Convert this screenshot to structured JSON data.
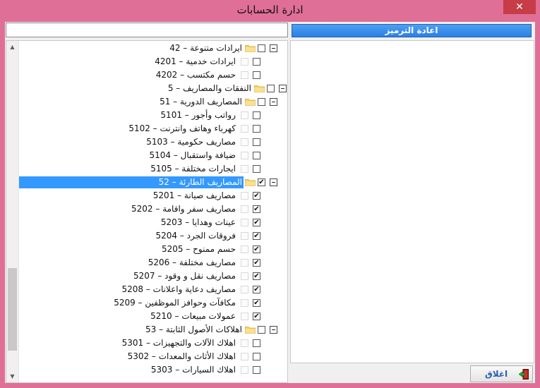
{
  "window": {
    "title": "ادارة الحسابات",
    "close_glyph": "✕"
  },
  "search": {
    "value": "",
    "placeholder": ""
  },
  "reset_button": {
    "label": "اعادة الترميز"
  },
  "close_button": {
    "label": "اغلاق"
  },
  "tree": [
    {
      "text": "42 – ايرادات متنوعة",
      "level": 1,
      "type": "folder",
      "checked": false
    },
    {
      "text": "4201 – ايرادات خدمية",
      "level": 2,
      "type": "leaf",
      "checked": false
    },
    {
      "text": "4202 – حسم مكتسب",
      "level": 2,
      "type": "leaf",
      "checked": false
    },
    {
      "text": "5 – النفقات والمصاريف",
      "level": 0,
      "type": "folder",
      "checked": false
    },
    {
      "text": "51 – المصاريف الدورية",
      "level": 1,
      "type": "folder",
      "checked": false
    },
    {
      "text": "5101 – رواتب وأجور",
      "level": 2,
      "type": "leaf",
      "checked": false
    },
    {
      "text": "5102 – كهرباء وهاتف وانترنت",
      "level": 2,
      "type": "leaf",
      "checked": false
    },
    {
      "text": "5103 – مصاريف حكومية",
      "level": 2,
      "type": "leaf",
      "checked": false
    },
    {
      "text": "5104 – ضيافة واستقبال",
      "level": 2,
      "type": "leaf",
      "checked": false
    },
    {
      "text": "5105 – ايجارات مختلفة",
      "level": 2,
      "type": "leaf",
      "checked": false
    },
    {
      "text": "52 – المصاريف الطارئة",
      "level": 1,
      "type": "folder",
      "checked": true,
      "selected": true
    },
    {
      "text": "5201 – مصاريف صيانة",
      "level": 2,
      "type": "leaf",
      "checked": true
    },
    {
      "text": "5202 – مصاريف سفر واقامة",
      "level": 2,
      "type": "leaf",
      "checked": true
    },
    {
      "text": "5203 – عينات وهدايا",
      "level": 2,
      "type": "leaf",
      "checked": true
    },
    {
      "text": "5204 – فروقات الجرد",
      "level": 2,
      "type": "leaf",
      "checked": true
    },
    {
      "text": "5205 – حسم ممنوح",
      "level": 2,
      "type": "leaf",
      "checked": true
    },
    {
      "text": "5206 – مصاريف مختلفة",
      "level": 2,
      "type": "leaf",
      "checked": true
    },
    {
      "text": "5207 – مصاريف نقل و وقود",
      "level": 2,
      "type": "leaf",
      "checked": true
    },
    {
      "text": "5208 – مصاريف دعاية واعلانات",
      "level": 2,
      "type": "leaf",
      "checked": true
    },
    {
      "text": "5209 – مكافآت وحوافز الموظفين",
      "level": 2,
      "type": "leaf",
      "checked": true
    },
    {
      "text": "5210 – عمولات مبيعات",
      "level": 2,
      "type": "leaf",
      "checked": true
    },
    {
      "text": "53 – اهلاكات الأصول الثابتة",
      "level": 1,
      "type": "folder",
      "checked": false
    },
    {
      "text": "5301 – اهلاك الآلات والتجهيزات",
      "level": 2,
      "type": "leaf",
      "checked": false
    },
    {
      "text": "5302 – اهلاك الأثاث والمعدات",
      "level": 2,
      "type": "leaf",
      "checked": false
    },
    {
      "text": "5303 – اهلاك السيارات",
      "level": 2,
      "type": "leaf",
      "checked": false
    }
  ],
  "colors": {
    "window_frame": "#df6f97",
    "selection": "#3399ff",
    "button_blue": "#2a80e6",
    "close_red": "#c73c46"
  },
  "icons": {
    "folder": "folder-icon",
    "expander": "collapse-icon",
    "exit": "exit-door-icon"
  }
}
